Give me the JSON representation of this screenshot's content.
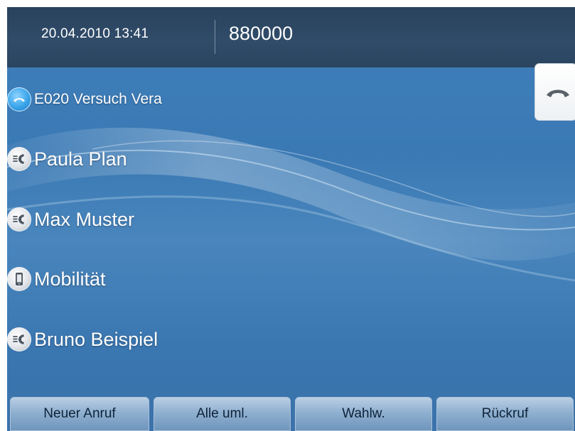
{
  "header": {
    "datetime": "20.04.2010 13:41",
    "number": "880000"
  },
  "list": {
    "items": [
      {
        "label": "E020 Versuch Vera",
        "icon": "handset-icon",
        "state": "active"
      },
      {
        "label": "Paula Plan",
        "icon": "voice-call-icon",
        "state": "idle"
      },
      {
        "label": "Max Muster",
        "icon": "voice-call-icon",
        "state": "idle"
      },
      {
        "label": "Mobilität",
        "icon": "mobile-phone-icon",
        "state": "idle"
      },
      {
        "label": "Bruno Beispiel",
        "icon": "voice-call-icon",
        "state": "idle"
      }
    ]
  },
  "side_button": {
    "icon": "hang-up-icon"
  },
  "softkeys": [
    {
      "label": "Neuer Anruf"
    },
    {
      "label": "Alle uml."
    },
    {
      "label": "Wahlw."
    },
    {
      "label": "Rückruf"
    }
  ],
  "colors": {
    "header_bg": "#2b4560",
    "screen_bg": "#3f7fbb",
    "active_icon": "#3aa5ea",
    "softkey_bg": "#8fb0d0",
    "text": "#ffffff"
  }
}
